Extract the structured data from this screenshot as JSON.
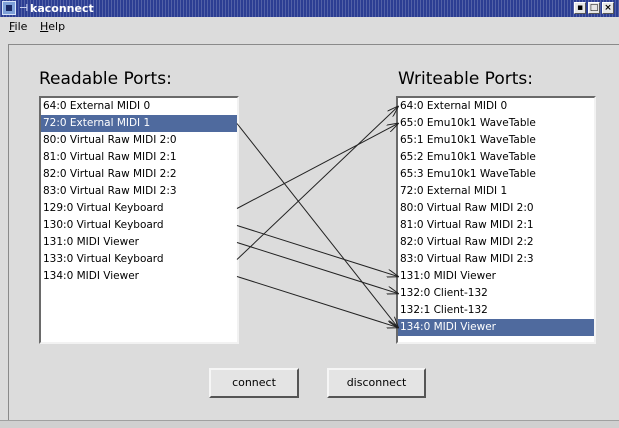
{
  "window": {
    "title": "kaconnect"
  },
  "menu": [
    {
      "label": "File",
      "mnemonic": "F",
      "rest": "ile"
    },
    {
      "label": "Help",
      "mnemonic": "H",
      "rest": "elp"
    }
  ],
  "readable": {
    "title": "Readable Ports:",
    "ports": [
      "64:0 External MIDI 0",
      "72:0 External MIDI 1",
      "80:0 Virtual Raw MIDI 2:0",
      "81:0 Virtual Raw MIDI 2:1",
      "82:0 Virtual Raw MIDI 2:2",
      "83:0 Virtual Raw MIDI 2:3",
      "129:0 Virtual Keyboard",
      "130:0 Virtual Keyboard",
      "131:0 MIDI Viewer",
      "133:0 Virtual Keyboard",
      "134:0 MIDI Viewer"
    ],
    "selected_index": 1
  },
  "writeable": {
    "title": "Writeable Ports:",
    "ports": [
      "64:0 External MIDI 0",
      "65:0 Emu10k1 WaveTable",
      "65:1 Emu10k1 WaveTable",
      "65:2 Emu10k1 WaveTable",
      "65:3 Emu10k1 WaveTable",
      "72:0 External MIDI 1",
      "80:0 Virtual Raw MIDI 2:0",
      "81:0 Virtual Raw MIDI 2:1",
      "82:0 Virtual Raw MIDI 2:2",
      "83:0 Virtual Raw MIDI 2:3",
      "131:0 MIDI Viewer",
      "132:0 Client-132",
      "132:1 Client-132",
      "134:0 MIDI Viewer"
    ],
    "selected_index": 13
  },
  "connections": [
    {
      "from": 1,
      "to": 13
    },
    {
      "from": 6,
      "to": 1
    },
    {
      "from": 7,
      "to": 10
    },
    {
      "from": 8,
      "to": 11
    },
    {
      "from": 9,
      "to": 0
    },
    {
      "from": 10,
      "to": 13
    }
  ],
  "buttons": {
    "connect": "connect",
    "disconnect": "disconnect"
  },
  "colors": {
    "selection": "#4f6a9e",
    "titlebar": "#2c3e93"
  }
}
